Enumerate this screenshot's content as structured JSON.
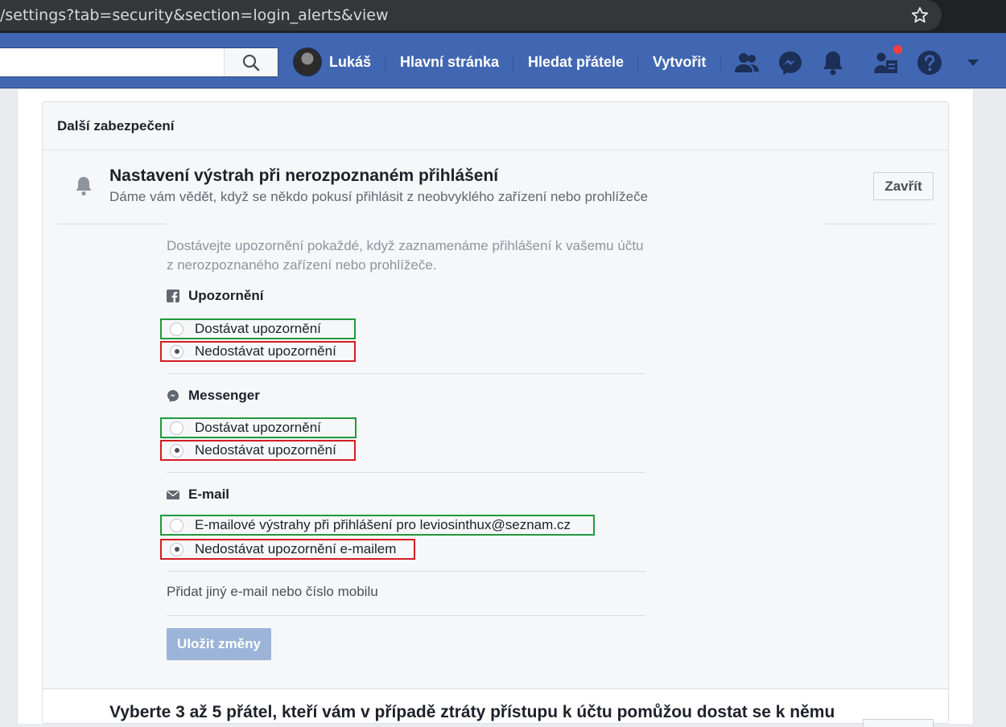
{
  "browser": {
    "url": "/settings?tab=security&section=login_alerts&view"
  },
  "topbar": {
    "search_placeholder": "",
    "user_name": "Lukáš",
    "nav": {
      "home": "Hlavní stránka",
      "find_friends": "Hledat přátele",
      "create": "Vytvořit"
    },
    "icons": [
      "friend-requests-icon",
      "messenger-icon",
      "notifications-icon",
      "pages-icon",
      "help-icon",
      "dropdown-icon"
    ],
    "brand_color": "#4267b2",
    "badge_color": "#fa3e3e"
  },
  "card": {
    "header_title": "Další zabezpečení",
    "alert_title": "Nastavení výstrah při nerozpoznaném přihlášení",
    "alert_subtitle": "Dáme vám vědět, když se někdo pokusí přihlásit z neobvyklého zařízení nebo prohlížeče",
    "close_label": "Zavřít",
    "description": "Dostávejte upozornění pokaždé, když zaznamenáme přihlášení k vašemu účtu z nerozpoznaného zařízení nebo prohlížeče.",
    "sections": [
      {
        "title": "Upozornění",
        "icon": "facebook-icon",
        "options": [
          {
            "label": "Dostávat upozornění",
            "checked": false,
            "highlight": "#1f9a3f"
          },
          {
            "label": "Nedostávat upozornění",
            "checked": true,
            "highlight": "#d31c23"
          }
        ]
      },
      {
        "title": "Messenger",
        "icon": "messenger-icon",
        "options": [
          {
            "label": "Dostávat upozornění",
            "checked": false,
            "highlight": "#1f9a3f"
          },
          {
            "label": "Nedostávat upozornění",
            "checked": true,
            "highlight": "#d31c23"
          }
        ]
      },
      {
        "title": "E-mail",
        "icon": "envelope-icon",
        "options": [
          {
            "label": "E-mailové výstrahy při přihlášení pro leviosinthux@seznam.cz",
            "checked": false,
            "highlight": "#1f9a3f"
          },
          {
            "label": "Nedostávat upozornění e-mailem",
            "checked": true,
            "highlight": "#d31c23"
          }
        ]
      }
    ],
    "add_contact_link": "Přidat jiný e-mail nebo číslo mobilu",
    "save_label": "Uložit změny"
  },
  "next_section": {
    "title": "Vyberte 3 až 5 přátel, kteří vám v případě ztráty přístupu k účtu pomůžou dostat se k němu"
  }
}
